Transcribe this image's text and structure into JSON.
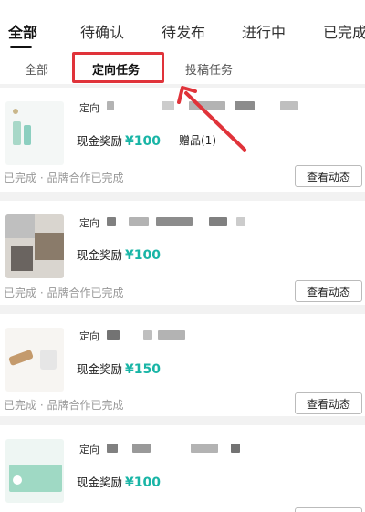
{
  "top_tabs": [
    "全部",
    "待确认",
    "待发布",
    "进行中",
    "已完成"
  ],
  "sub_tabs": [
    "全部",
    "定向任务",
    "投稿任务"
  ],
  "cards": [
    {
      "tag": "定向",
      "reward_label": "现金奖励",
      "reward_value": "¥100",
      "gift": "赠品(1)",
      "status": "已完成 · 品牌合作已完成",
      "button": "查看动态"
    },
    {
      "tag": "定向",
      "reward_label": "现金奖励",
      "reward_value": "¥100",
      "status": "已完成 · 品牌合作已完成",
      "button": "查看动态"
    },
    {
      "tag": "定向",
      "reward_label": "现金奖励",
      "reward_value": "¥150",
      "status": "已完成 · 品牌合作已完成",
      "button": "查看动态"
    },
    {
      "tag": "定向",
      "reward_label": "现金奖励",
      "reward_value": "¥100"
    }
  ],
  "colors": {
    "accent": "#19b5a6",
    "highlight": "#e0333a"
  }
}
